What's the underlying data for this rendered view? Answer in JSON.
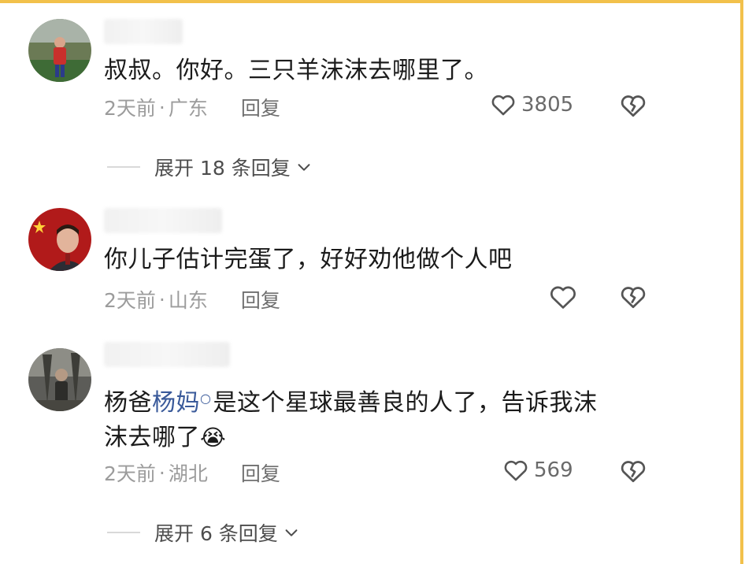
{
  "comments": [
    {
      "text": "叔叔。你好。三只羊沫沫去哪里了。",
      "time": "2天前",
      "location": "广东",
      "reply_label": "回复",
      "likes": "3805",
      "expand": "展开 18 条回复"
    },
    {
      "text": "你儿子估计完蛋了，好好劝他做个人吧",
      "time": "2天前",
      "location": "山东",
      "reply_label": "回复",
      "likes": ""
    },
    {
      "text_prefix": "杨爸",
      "mention": "杨妈",
      "text_line1": "是这个星球最善良的人了，告诉我沫",
      "text_line2": "沫去哪了",
      "emoji": "😭",
      "time": "2天前",
      "location": "湖北",
      "reply_label": "回复",
      "likes": "569",
      "expand": "展开 6 条回复"
    }
  ],
  "meta_separator": "·",
  "icons": {
    "like": "heart-outline-icon",
    "dislike": "broken-heart-icon",
    "expand": "chevron-down-icon",
    "mention": "search-icon"
  },
  "colors": {
    "frame": "#f2c14b",
    "mention": "#3a5a9a",
    "meta": "#9c9c9c"
  }
}
